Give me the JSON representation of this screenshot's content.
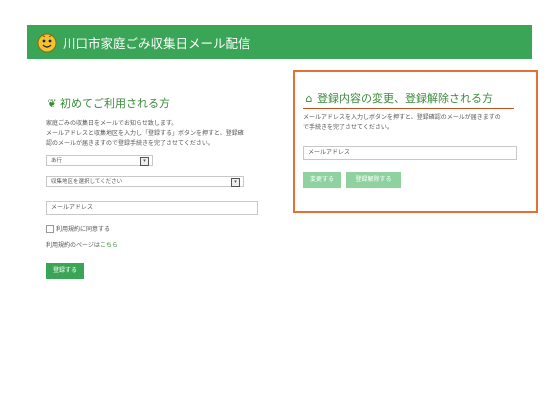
{
  "header": {
    "title": "川口市家庭ごみ収集日メール配信"
  },
  "first_time": {
    "heading": "初めてご利用される方",
    "description_line1": "家庭ごみの収集日をメールでお知らせ致します。",
    "description_line2": "メールアドレスと収集地区を入力し「登録する」ボタンを押すと、登録確",
    "description_line3": "認のメールが届きますので登録手続きを完了させてください。",
    "row_select": "あ行",
    "district_select": "収集地区を選択してください",
    "email_placeholder": "メールアドレス",
    "agree_label": "利用規約に同意する",
    "terms_prefix": "利用規約のページは",
    "terms_link": "こちら",
    "register_button": "登録する"
  },
  "change_unsubscribe": {
    "heading": "登録内容の変更、登録解除される方",
    "description_line1": "メールアドレスを入力しボタンを押すと、登録確認のメールが届きますの",
    "description_line2": "で手続きを完了させてください。",
    "email_placeholder": "メールアドレス",
    "change_button": "変更する",
    "unsubscribe_button": "登録解除する"
  },
  "colors": {
    "brand_green": "#3aa556",
    "highlight_orange": "#e07338"
  }
}
